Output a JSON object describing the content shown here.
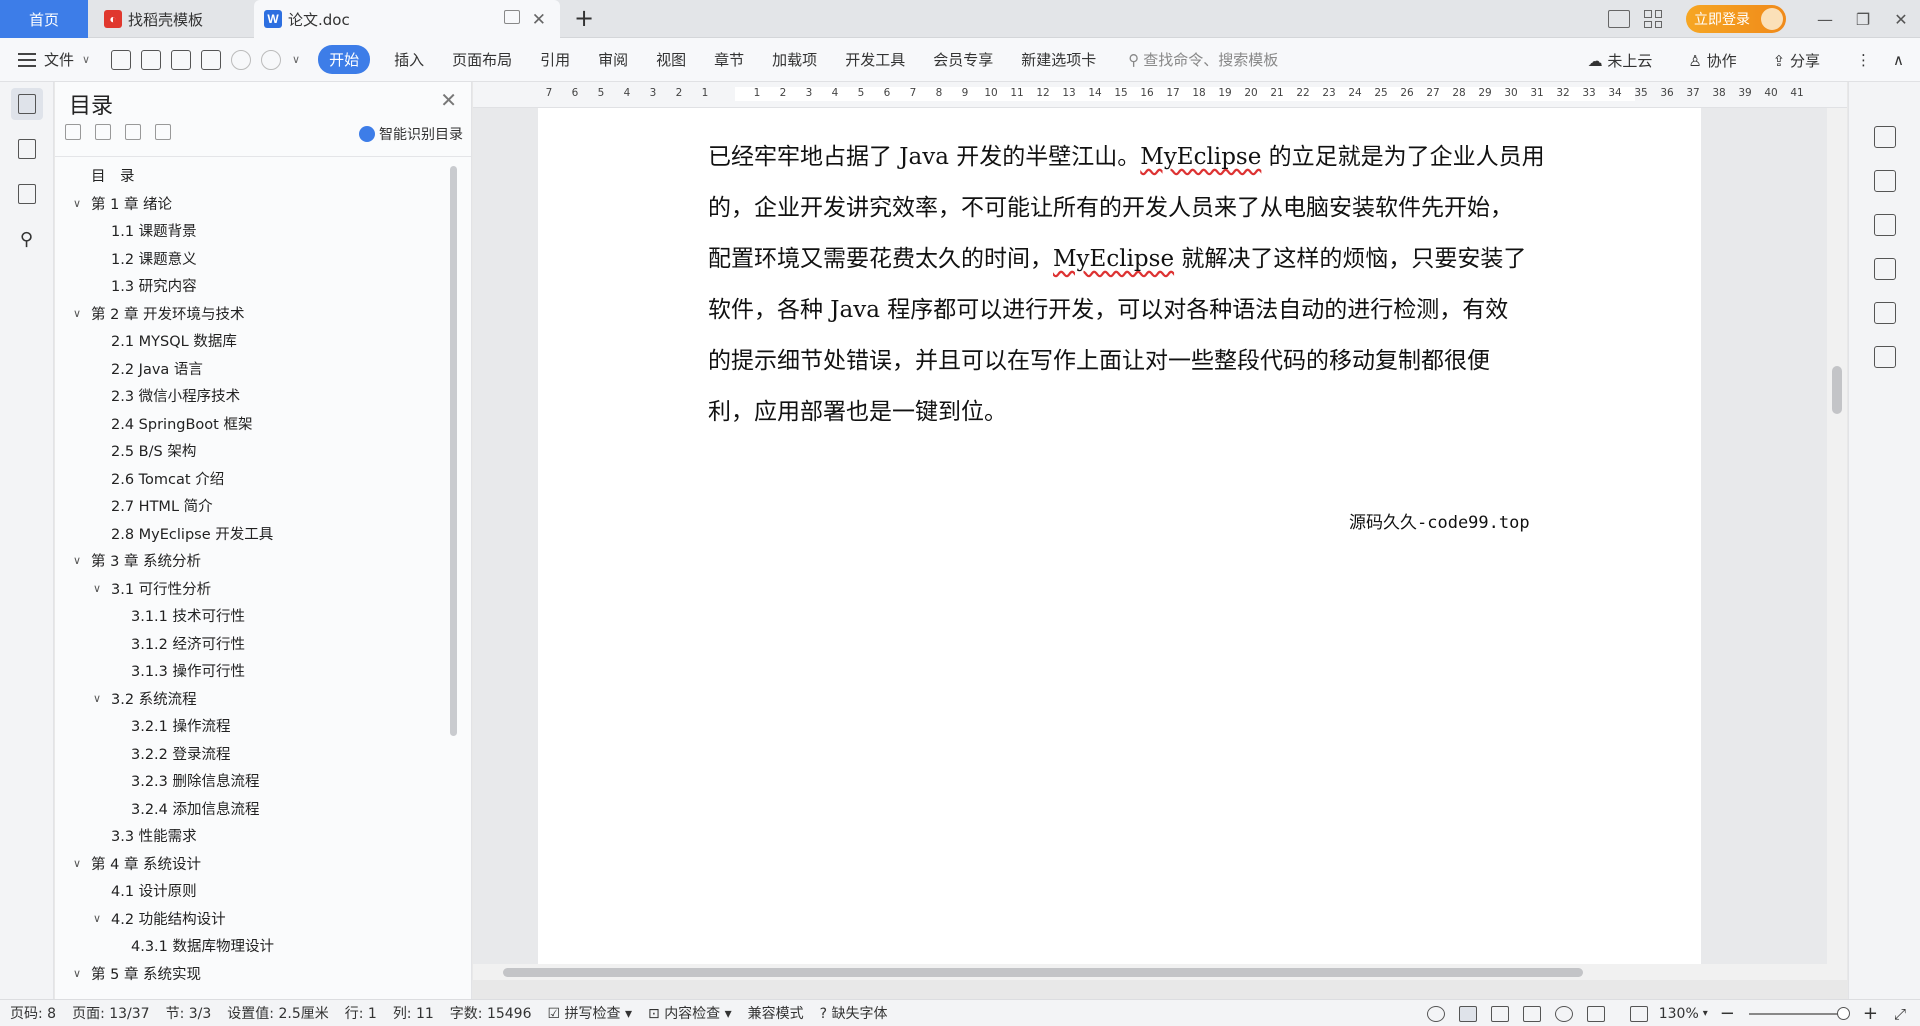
{
  "tabs": {
    "home": "首页",
    "template": "找稻壳模板",
    "doc": "论文.doc",
    "login": "立即登录"
  },
  "toolbar": {
    "file": "文件",
    "menus": [
      "开始",
      "插入",
      "页面布局",
      "引用",
      "审阅",
      "视图",
      "章节",
      "加载项",
      "开发工具",
      "会员专享",
      "新建选项卡"
    ],
    "search_placeholder": "查找命令、搜索模板",
    "cloud": "未上云",
    "collab": "协作",
    "share": "分享"
  },
  "toc": {
    "title": "目录",
    "smart": "智能识别目录",
    "items": [
      {
        "label": "目　录",
        "level": 0,
        "arrow": ""
      },
      {
        "label": "第 1 章  绪论",
        "level": 0,
        "arrow": "v"
      },
      {
        "label": "1.1  课题背景",
        "level": 1,
        "arrow": ""
      },
      {
        "label": "1.2  课题意义",
        "level": 1,
        "arrow": ""
      },
      {
        "label": "1.3  研究内容",
        "level": 1,
        "arrow": ""
      },
      {
        "label": "第 2 章  开发环境与技术",
        "level": 0,
        "arrow": "v"
      },
      {
        "label": "2.1  MYSQL 数据库",
        "level": 1,
        "arrow": ""
      },
      {
        "label": "2.2  Java 语言",
        "level": 1,
        "arrow": ""
      },
      {
        "label": "2.3  微信小程序技术",
        "level": 1,
        "arrow": ""
      },
      {
        "label": "2.4  SpringBoot 框架",
        "level": 1,
        "arrow": ""
      },
      {
        "label": "2.5  B/S 架构",
        "level": 1,
        "arrow": ""
      },
      {
        "label": "2.6  Tomcat  介绍",
        "level": 1,
        "arrow": ""
      },
      {
        "label": "2.7  HTML 简介",
        "level": 1,
        "arrow": ""
      },
      {
        "label": "2.8  MyEclipse 开发工具",
        "level": 1,
        "arrow": ""
      },
      {
        "label": "第 3 章  系统分析",
        "level": 0,
        "arrow": "v"
      },
      {
        "label": "3.1  可行性分析",
        "level": 1,
        "arrow": "v"
      },
      {
        "label": "3.1.1  技术可行性",
        "level": 2,
        "arrow": ""
      },
      {
        "label": "3.1.2  经济可行性",
        "level": 2,
        "arrow": ""
      },
      {
        "label": "3.1.3  操作可行性",
        "level": 2,
        "arrow": ""
      },
      {
        "label": "3.2  系统流程",
        "level": 1,
        "arrow": "v"
      },
      {
        "label": "3.2.1  操作流程",
        "level": 2,
        "arrow": ""
      },
      {
        "label": "3.2.2  登录流程",
        "level": 2,
        "arrow": ""
      },
      {
        "label": "3.2.3  删除信息流程",
        "level": 2,
        "arrow": ""
      },
      {
        "label": "3.2.4  添加信息流程",
        "level": 2,
        "arrow": ""
      },
      {
        "label": "3.3  性能需求",
        "level": 1,
        "arrow": ""
      },
      {
        "label": "第 4 章  系统设计",
        "level": 0,
        "arrow": "v"
      },
      {
        "label": "4.1  设计原则",
        "level": 1,
        "arrow": ""
      },
      {
        "label": "4.2  功能结构设计",
        "level": 1,
        "arrow": "v"
      },
      {
        "label": "4.3.1  数据库物理设计",
        "level": 2,
        "arrow": ""
      },
      {
        "label": "第 5 章  系统实现",
        "level": 0,
        "arrow": "v"
      }
    ]
  },
  "ruler": {
    "labels": [
      "7",
      "6",
      "5",
      "4",
      "3",
      "2",
      "1",
      "",
      "1",
      "2",
      "3",
      "4",
      "5",
      "6",
      "7",
      "8",
      "9",
      "10",
      "11",
      "12",
      "13",
      "14",
      "15",
      "16",
      "17",
      "18",
      "19",
      "20",
      "21",
      "22",
      "23",
      "24",
      "25",
      "26",
      "27",
      "28",
      "29",
      "30",
      "31",
      "32",
      "33",
      "34",
      "35",
      "36",
      "37",
      "38",
      "39",
      "40",
      "41"
    ]
  },
  "document": {
    "lines": [
      {
        "parts": [
          {
            "t": "已经牢牢地占据了 Java 开发的半壁江山。"
          },
          {
            "t": "MyEclipse",
            "ul": true
          },
          {
            "t": " 的立足就是为了企业人员用"
          }
        ]
      },
      {
        "parts": [
          {
            "t": "的，企业开发讲究效率，不可能让所有的开发人员来了从电脑安装软件先开始，"
          }
        ]
      },
      {
        "parts": [
          {
            "t": "配置环境又需要花费太久的时间，"
          },
          {
            "t": "MyEclipse",
            "ul": true
          },
          {
            "t": " 就解决了这样的烦恼，只要安装了"
          }
        ]
      },
      {
        "parts": [
          {
            "t": "软件，各种 Java 程序都可以进行开发，可以对各种语法自动的进行检测，有效"
          }
        ]
      },
      {
        "parts": [
          {
            "t": "的提示细节处错误，并且可以在写作上面让对一些整段代码的移动复制都很便"
          }
        ]
      },
      {
        "parts": [
          {
            "t": "利，应用部署也是一键到位。"
          }
        ]
      }
    ],
    "footer": "源码久久-code99.top"
  },
  "status": {
    "page_code": "页码: 8",
    "page": "页面: 13/37",
    "section": "节: 3/3",
    "setting": "设置值: 2.5厘米",
    "row": "行: 1",
    "col": "列: 11",
    "words": "字数: 15496",
    "spell": "拼写检查",
    "content": "内容检查",
    "compat": "兼容模式",
    "font": "缺失字体",
    "zoom": "130%"
  },
  "colors": {
    "accent": "#3d7de8",
    "login": "#f6a623"
  }
}
